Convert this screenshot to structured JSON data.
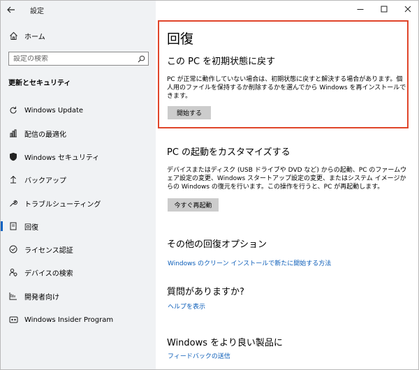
{
  "app": {
    "title": "設定"
  },
  "sidebar": {
    "home_label": "ホーム",
    "search_placeholder": "設定の検索",
    "section_title": "更新とセキュリティ",
    "items": [
      {
        "label": "Windows Update",
        "icon": "refresh-icon"
      },
      {
        "label": "配信の最適化",
        "icon": "delivery-optimization-icon"
      },
      {
        "label": "Windows セキュリティ",
        "icon": "shield-icon"
      },
      {
        "label": "バックアップ",
        "icon": "backup-arrow-icon"
      },
      {
        "label": "トラブルシューティング",
        "icon": "wrench-icon"
      },
      {
        "label": "回復",
        "icon": "recovery-icon",
        "active": true
      },
      {
        "label": "ライセンス認証",
        "icon": "check-circle-icon"
      },
      {
        "label": "デバイスの検索",
        "icon": "person-location-icon"
      },
      {
        "label": "開発者向け",
        "icon": "developer-icon"
      },
      {
        "label": "Windows Insider Program",
        "icon": "insider-icon"
      }
    ]
  },
  "main": {
    "title": "回復",
    "reset": {
      "heading": "この PC を初期状態に戻す",
      "description": "PC が正常に動作していない場合は、初期状態に戻すと解決する場合があります。個人用のファイルを保持するか削除するかを選んでから Windows を再インストールできます。",
      "button": "開始する"
    },
    "advanced": {
      "heading": "PC の起動をカスタマイズする",
      "description": "デバイスまたはディスク (USB ドライブや DVD など) からの起動、PC のファームウェア設定の変更、Windows スタートアップ設定の変更、またはシステム イメージからの Windows の復元を行います。この操作を行うと、PC が再起動します。",
      "button": "今すぐ再起動"
    },
    "other": {
      "heading": "その他の回復オプション",
      "link": "Windows のクリーン インストールで新たに開始する方法"
    },
    "questions": {
      "heading": "質問がありますか?",
      "link": "ヘルプを表示"
    },
    "improve": {
      "heading": "Windows をより良い製品に",
      "link": "フィードバックの送信"
    }
  },
  "colors": {
    "accent": "#0a62c2",
    "link": "#0a5cb8",
    "highlight_border": "#e0452a",
    "sidebar_bg": "#f0f2f4",
    "button_bg": "#cccccc"
  }
}
